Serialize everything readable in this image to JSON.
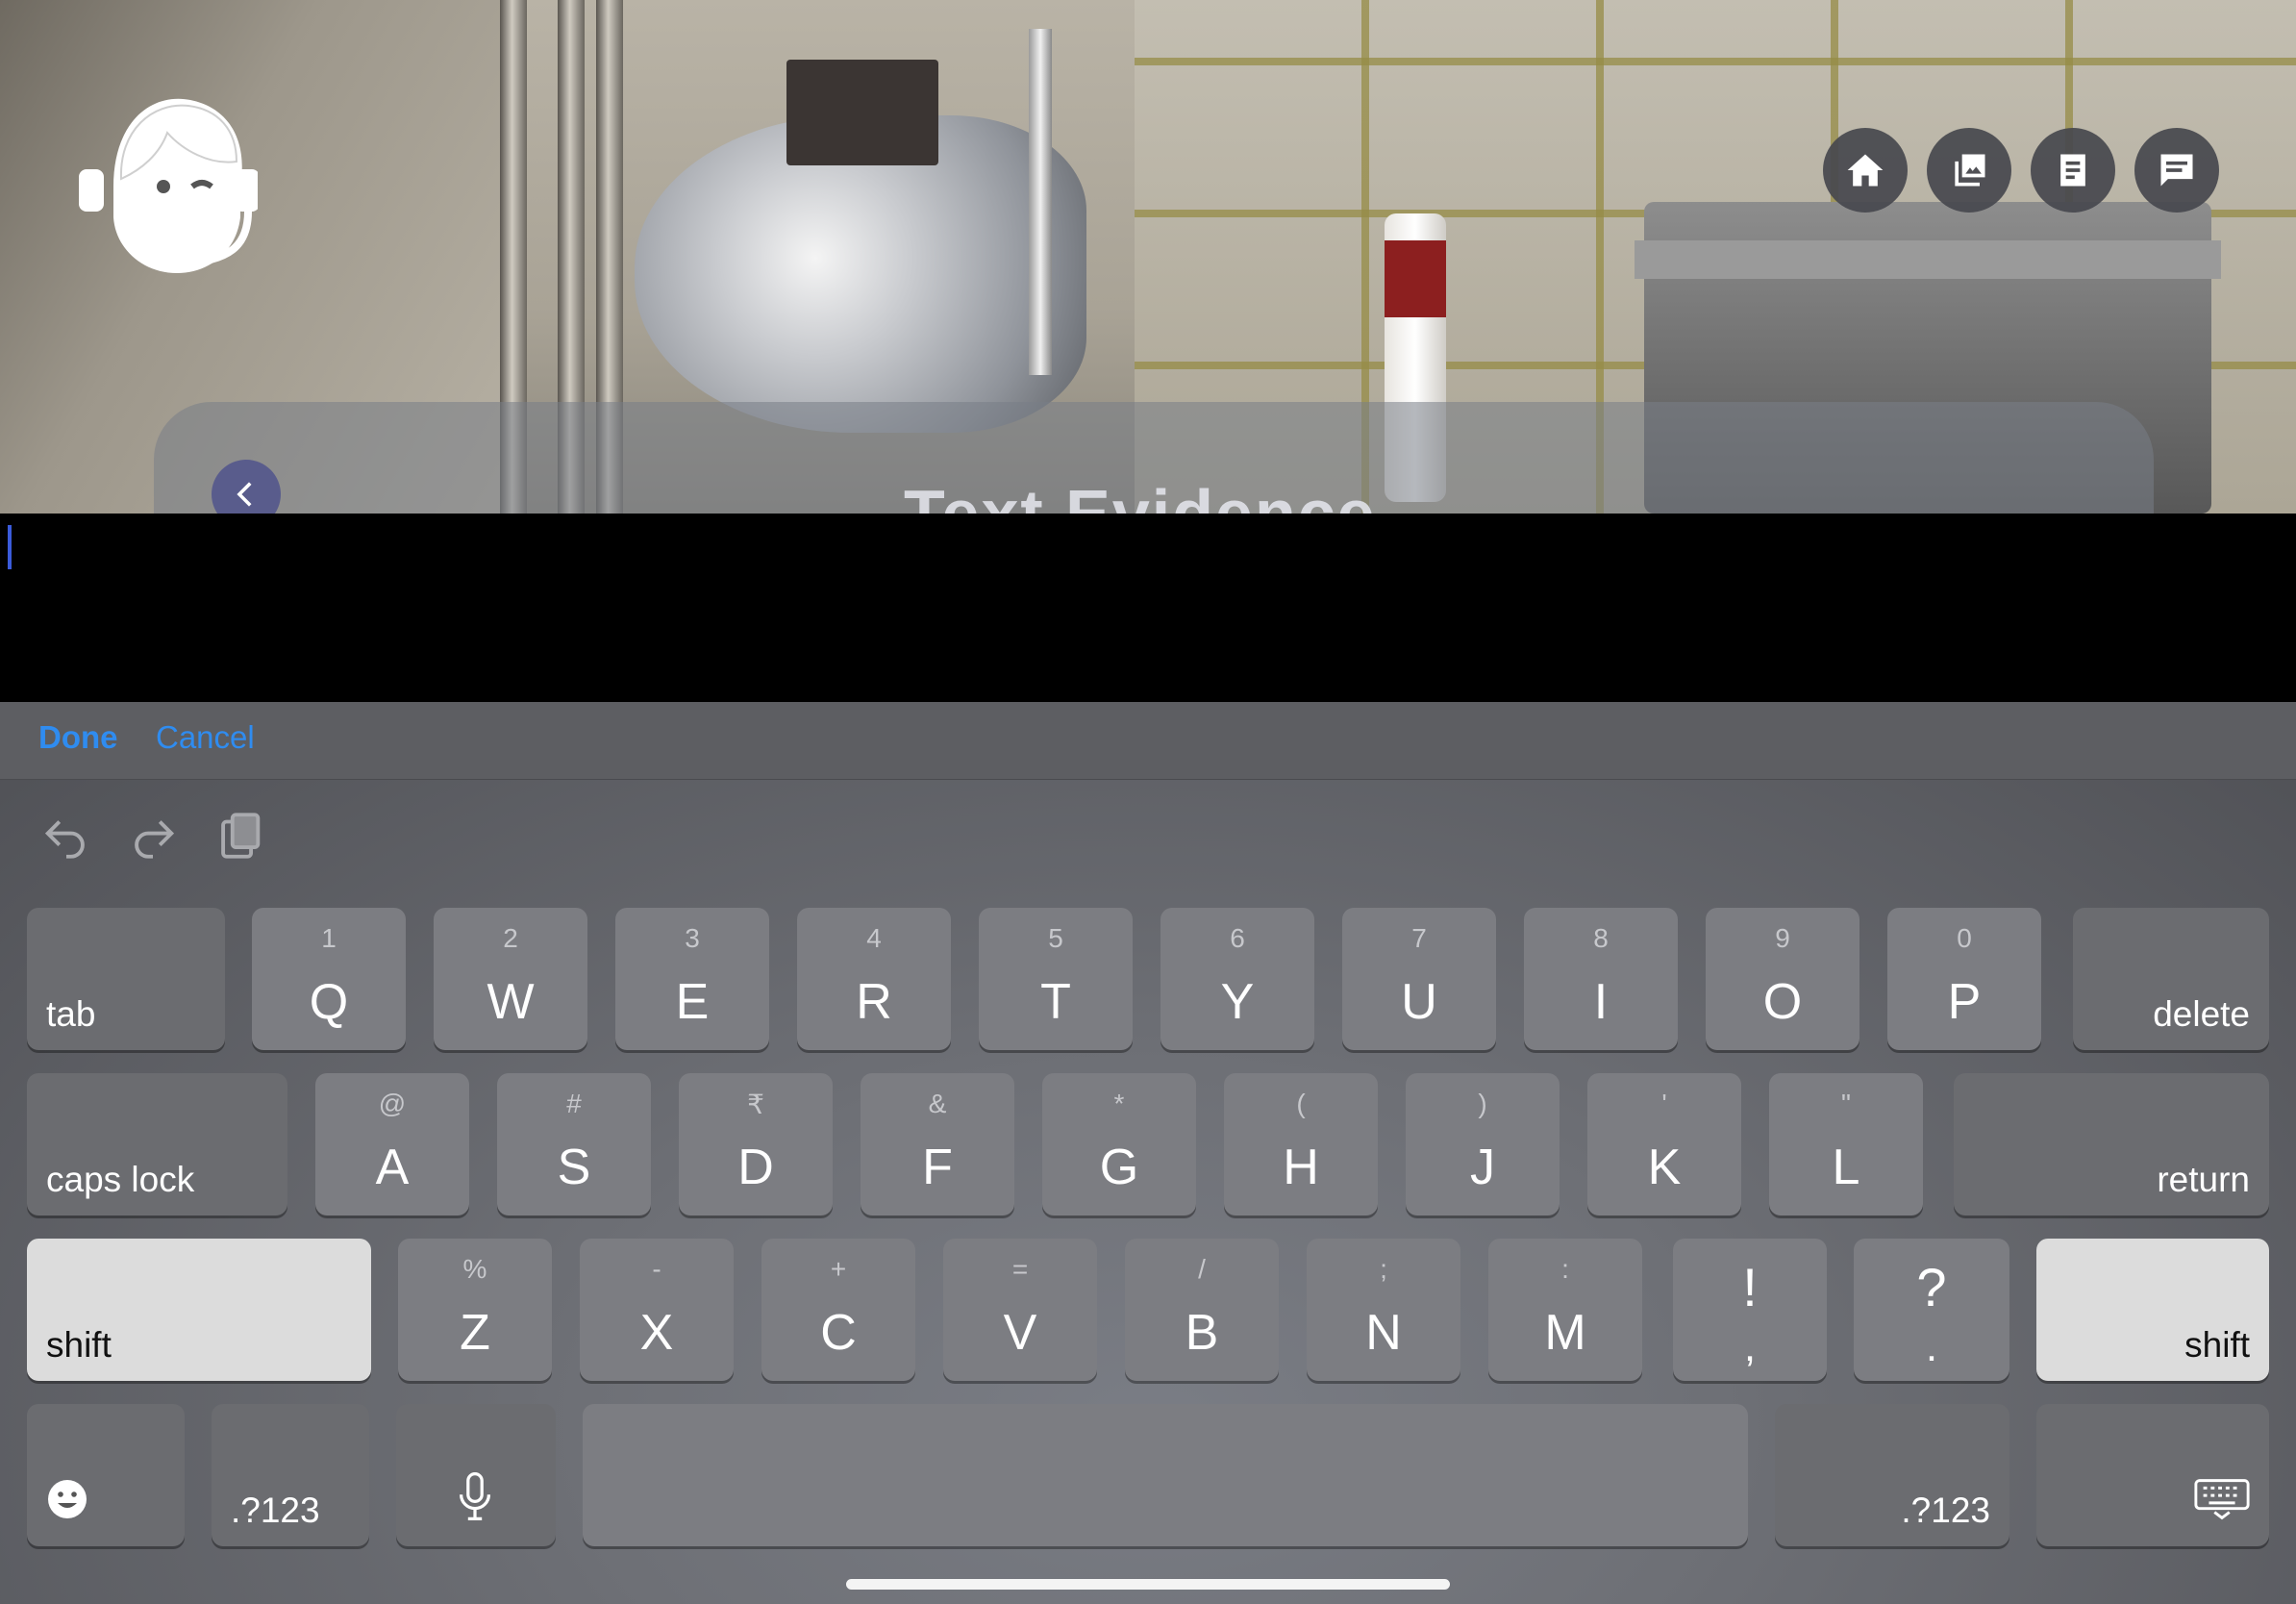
{
  "overlay": {
    "title": "Text Evidence",
    "top_icons": [
      "home-icon",
      "gallery-icon",
      "notes-icon",
      "chat-icon"
    ]
  },
  "accessory": {
    "done": "Done",
    "cancel": "Cancel"
  },
  "keyboard": {
    "row1": [
      {
        "hint": "1",
        "key": "Q"
      },
      {
        "hint": "2",
        "key": "W"
      },
      {
        "hint": "3",
        "key": "E"
      },
      {
        "hint": "4",
        "key": "R"
      },
      {
        "hint": "5",
        "key": "T"
      },
      {
        "hint": "6",
        "key": "Y"
      },
      {
        "hint": "7",
        "key": "U"
      },
      {
        "hint": "8",
        "key": "I"
      },
      {
        "hint": "9",
        "key": "O"
      },
      {
        "hint": "0",
        "key": "P"
      }
    ],
    "row2": [
      {
        "hint": "@",
        "key": "A"
      },
      {
        "hint": "#",
        "key": "S"
      },
      {
        "hint": "₹",
        "key": "D"
      },
      {
        "hint": "&",
        "key": "F"
      },
      {
        "hint": "*",
        "key": "G"
      },
      {
        "hint": "(",
        "key": "H"
      },
      {
        "hint": ")",
        "key": "J"
      },
      {
        "hint": "'",
        "key": "K"
      },
      {
        "hint": "\"",
        "key": "L"
      }
    ],
    "row3": [
      {
        "hint": "%",
        "key": "Z"
      },
      {
        "hint": "-",
        "key": "X"
      },
      {
        "hint": "+",
        "key": "C"
      },
      {
        "hint": "=",
        "key": "V"
      },
      {
        "hint": "/",
        "key": "B"
      },
      {
        "hint": ";",
        "key": "N"
      },
      {
        "hint": ":",
        "key": "M"
      }
    ],
    "punct": [
      {
        "top": "!",
        "bottom": ","
      },
      {
        "top": "?",
        "bottom": "."
      }
    ],
    "tab": "tab",
    "delete": "delete",
    "caps_lock": "caps lock",
    "return": "return",
    "shift": "shift",
    "numbers": ".?123"
  }
}
